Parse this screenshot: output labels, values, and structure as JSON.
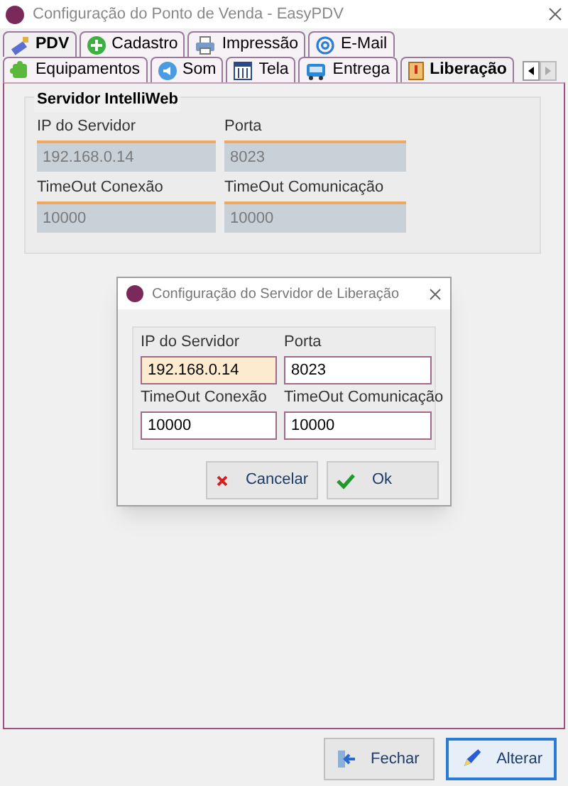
{
  "window": {
    "title": "Configuração do Ponto de Venda - EasyPDV"
  },
  "tabs": [
    {
      "label": "PDV",
      "selected": true
    },
    {
      "label": "Cadastro",
      "selected": false
    },
    {
      "label": "Impressão",
      "selected": false
    },
    {
      "label": "E-Mail",
      "selected": false
    }
  ],
  "subtabs": [
    {
      "label": "Equipamentos",
      "selected": false
    },
    {
      "label": "Som",
      "selected": false
    },
    {
      "label": "Tela",
      "selected": false
    },
    {
      "label": "Entrega",
      "selected": false
    },
    {
      "label": "Liberação",
      "selected": true
    }
  ],
  "group": {
    "title": "Servidor IntelliWeb",
    "fields": [
      {
        "label": "IP do Servidor",
        "value": "192.168.0.14",
        "disabled": true
      },
      {
        "label": "Porta",
        "value": "8023",
        "disabled": true
      },
      {
        "label": "TimeOut Conexão",
        "value": "10000",
        "disabled": true
      },
      {
        "label": "TimeOut Comunicação",
        "value": "10000",
        "disabled": true
      }
    ]
  },
  "dialog": {
    "title": "Configuração do Servidor de Liberação",
    "fields": [
      {
        "label": "IP do Servidor",
        "value": "192.168.0.14",
        "focused": true
      },
      {
        "label": "Porta",
        "value": "8023",
        "focused": false
      },
      {
        "label": "TimeOut Conexão",
        "value": "10000",
        "focused": false
      },
      {
        "label": "TimeOut Comunicação",
        "value": "10000",
        "focused": false
      }
    ],
    "buttons": [
      {
        "label": "Cancelar",
        "kind": "cancel"
      },
      {
        "label": "Ok",
        "kind": "ok"
      }
    ]
  },
  "buttons": [
    {
      "label": "Fechar",
      "kind": "close",
      "default": false
    },
    {
      "label": "Alterar",
      "kind": "edit",
      "default": true
    }
  ]
}
